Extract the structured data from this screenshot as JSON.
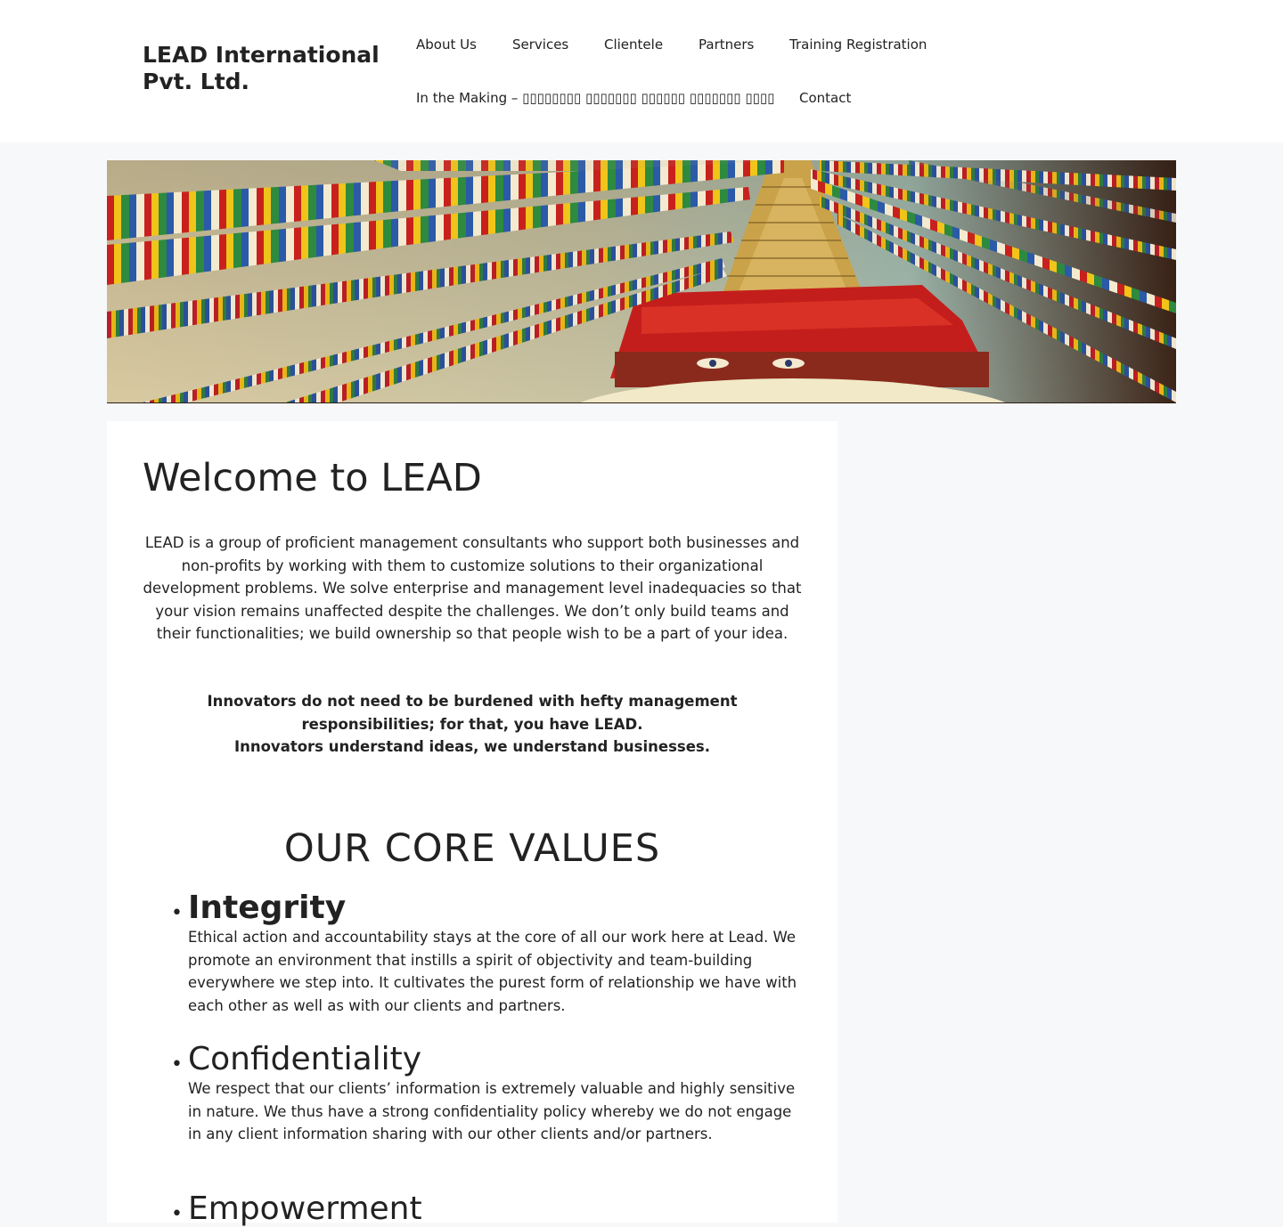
{
  "header": {
    "site_title_line1": "LEAD International",
    "site_title_line2": "Pvt. Ltd.",
    "nav": [
      {
        "label": "About Us"
      },
      {
        "label": "Services"
      },
      {
        "label": "Clientele"
      },
      {
        "label": "Partners"
      },
      {
        "label": "Training Registration"
      },
      {
        "label": "In the Making – ▯▯▯▯▯▯▯▯ ▯▯▯▯▯▯▯ ▯▯▯▯▯▯ ▯▯▯▯▯▯▯ ▯▯▯▯"
      },
      {
        "label": "Contact"
      }
    ]
  },
  "banner": {
    "icon": "prayer-flags-stupa-photo"
  },
  "main": {
    "title": "Welcome to LEAD",
    "intro": "LEAD is a group of proficient management consultants who support both businesses and non-profits by working with them to customize solutions to their organizational development problems. We solve enterprise and management level inadequacies so that your vision remains unaffected despite the challenges. We don’t only build teams and their functionalities; we build ownership so that people wish to be a part of your idea.",
    "tagline_line1": "Innovators do not need to be burdened with hefty management responsibilities; for that, you have LEAD.",
    "tagline_line2": "Innovators understand ideas, we understand businesses.",
    "values_title": "OUR CORE VALUES",
    "values": [
      {
        "heading": "Integrity",
        "description": "Ethical action and accountability stays at the core of all our work here at Lead. We promote an environment that instills a spirit of objectivity and team-building everywhere we step into. It cultivates the purest form of relationship we have with each other as well as with our clients and partners."
      },
      {
        "heading": "Confidentiality",
        "description": "We respect that our clients’ information is extremely valuable and highly sensitive in nature. We thus have a strong confidentiality policy whereby we do not engage in any client information sharing with our other clients and/or partners."
      },
      {
        "heading": "Empowerment",
        "description": ""
      }
    ]
  },
  "colors": {
    "page_background": "#f7f8f9",
    "surface": "#ffffff",
    "text": "#222222"
  }
}
